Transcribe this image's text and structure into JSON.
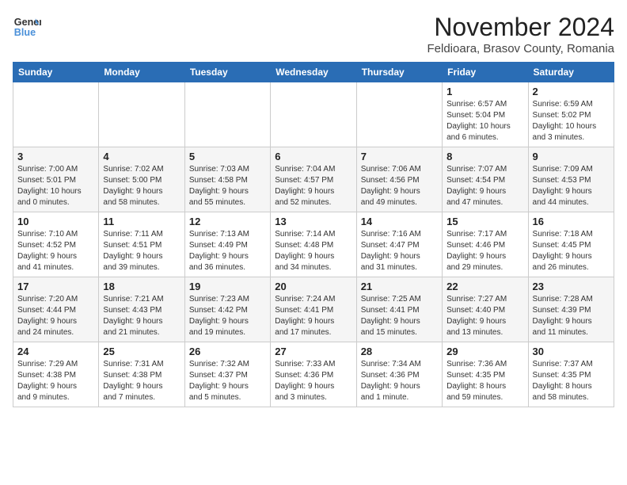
{
  "header": {
    "logo_line1": "General",
    "logo_line2": "Blue",
    "month_title": "November 2024",
    "subtitle": "Feldioara, Brasov County, Romania"
  },
  "weekdays": [
    "Sunday",
    "Monday",
    "Tuesday",
    "Wednesday",
    "Thursday",
    "Friday",
    "Saturday"
  ],
  "weeks": [
    [
      {
        "day": "",
        "info": ""
      },
      {
        "day": "",
        "info": ""
      },
      {
        "day": "",
        "info": ""
      },
      {
        "day": "",
        "info": ""
      },
      {
        "day": "",
        "info": ""
      },
      {
        "day": "1",
        "info": "Sunrise: 6:57 AM\nSunset: 5:04 PM\nDaylight: 10 hours\nand 6 minutes."
      },
      {
        "day": "2",
        "info": "Sunrise: 6:59 AM\nSunset: 5:02 PM\nDaylight: 10 hours\nand 3 minutes."
      }
    ],
    [
      {
        "day": "3",
        "info": "Sunrise: 7:00 AM\nSunset: 5:01 PM\nDaylight: 10 hours\nand 0 minutes."
      },
      {
        "day": "4",
        "info": "Sunrise: 7:02 AM\nSunset: 5:00 PM\nDaylight: 9 hours\nand 58 minutes."
      },
      {
        "day": "5",
        "info": "Sunrise: 7:03 AM\nSunset: 4:58 PM\nDaylight: 9 hours\nand 55 minutes."
      },
      {
        "day": "6",
        "info": "Sunrise: 7:04 AM\nSunset: 4:57 PM\nDaylight: 9 hours\nand 52 minutes."
      },
      {
        "day": "7",
        "info": "Sunrise: 7:06 AM\nSunset: 4:56 PM\nDaylight: 9 hours\nand 49 minutes."
      },
      {
        "day": "8",
        "info": "Sunrise: 7:07 AM\nSunset: 4:54 PM\nDaylight: 9 hours\nand 47 minutes."
      },
      {
        "day": "9",
        "info": "Sunrise: 7:09 AM\nSunset: 4:53 PM\nDaylight: 9 hours\nand 44 minutes."
      }
    ],
    [
      {
        "day": "10",
        "info": "Sunrise: 7:10 AM\nSunset: 4:52 PM\nDaylight: 9 hours\nand 41 minutes."
      },
      {
        "day": "11",
        "info": "Sunrise: 7:11 AM\nSunset: 4:51 PM\nDaylight: 9 hours\nand 39 minutes."
      },
      {
        "day": "12",
        "info": "Sunrise: 7:13 AM\nSunset: 4:49 PM\nDaylight: 9 hours\nand 36 minutes."
      },
      {
        "day": "13",
        "info": "Sunrise: 7:14 AM\nSunset: 4:48 PM\nDaylight: 9 hours\nand 34 minutes."
      },
      {
        "day": "14",
        "info": "Sunrise: 7:16 AM\nSunset: 4:47 PM\nDaylight: 9 hours\nand 31 minutes."
      },
      {
        "day": "15",
        "info": "Sunrise: 7:17 AM\nSunset: 4:46 PM\nDaylight: 9 hours\nand 29 minutes."
      },
      {
        "day": "16",
        "info": "Sunrise: 7:18 AM\nSunset: 4:45 PM\nDaylight: 9 hours\nand 26 minutes."
      }
    ],
    [
      {
        "day": "17",
        "info": "Sunrise: 7:20 AM\nSunset: 4:44 PM\nDaylight: 9 hours\nand 24 minutes."
      },
      {
        "day": "18",
        "info": "Sunrise: 7:21 AM\nSunset: 4:43 PM\nDaylight: 9 hours\nand 21 minutes."
      },
      {
        "day": "19",
        "info": "Sunrise: 7:23 AM\nSunset: 4:42 PM\nDaylight: 9 hours\nand 19 minutes."
      },
      {
        "day": "20",
        "info": "Sunrise: 7:24 AM\nSunset: 4:41 PM\nDaylight: 9 hours\nand 17 minutes."
      },
      {
        "day": "21",
        "info": "Sunrise: 7:25 AM\nSunset: 4:41 PM\nDaylight: 9 hours\nand 15 minutes."
      },
      {
        "day": "22",
        "info": "Sunrise: 7:27 AM\nSunset: 4:40 PM\nDaylight: 9 hours\nand 13 minutes."
      },
      {
        "day": "23",
        "info": "Sunrise: 7:28 AM\nSunset: 4:39 PM\nDaylight: 9 hours\nand 11 minutes."
      }
    ],
    [
      {
        "day": "24",
        "info": "Sunrise: 7:29 AM\nSunset: 4:38 PM\nDaylight: 9 hours\nand 9 minutes."
      },
      {
        "day": "25",
        "info": "Sunrise: 7:31 AM\nSunset: 4:38 PM\nDaylight: 9 hours\nand 7 minutes."
      },
      {
        "day": "26",
        "info": "Sunrise: 7:32 AM\nSunset: 4:37 PM\nDaylight: 9 hours\nand 5 minutes."
      },
      {
        "day": "27",
        "info": "Sunrise: 7:33 AM\nSunset: 4:36 PM\nDaylight: 9 hours\nand 3 minutes."
      },
      {
        "day": "28",
        "info": "Sunrise: 7:34 AM\nSunset: 4:36 PM\nDaylight: 9 hours\nand 1 minute."
      },
      {
        "day": "29",
        "info": "Sunrise: 7:36 AM\nSunset: 4:35 PM\nDaylight: 8 hours\nand 59 minutes."
      },
      {
        "day": "30",
        "info": "Sunrise: 7:37 AM\nSunset: 4:35 PM\nDaylight: 8 hours\nand 58 minutes."
      }
    ]
  ]
}
